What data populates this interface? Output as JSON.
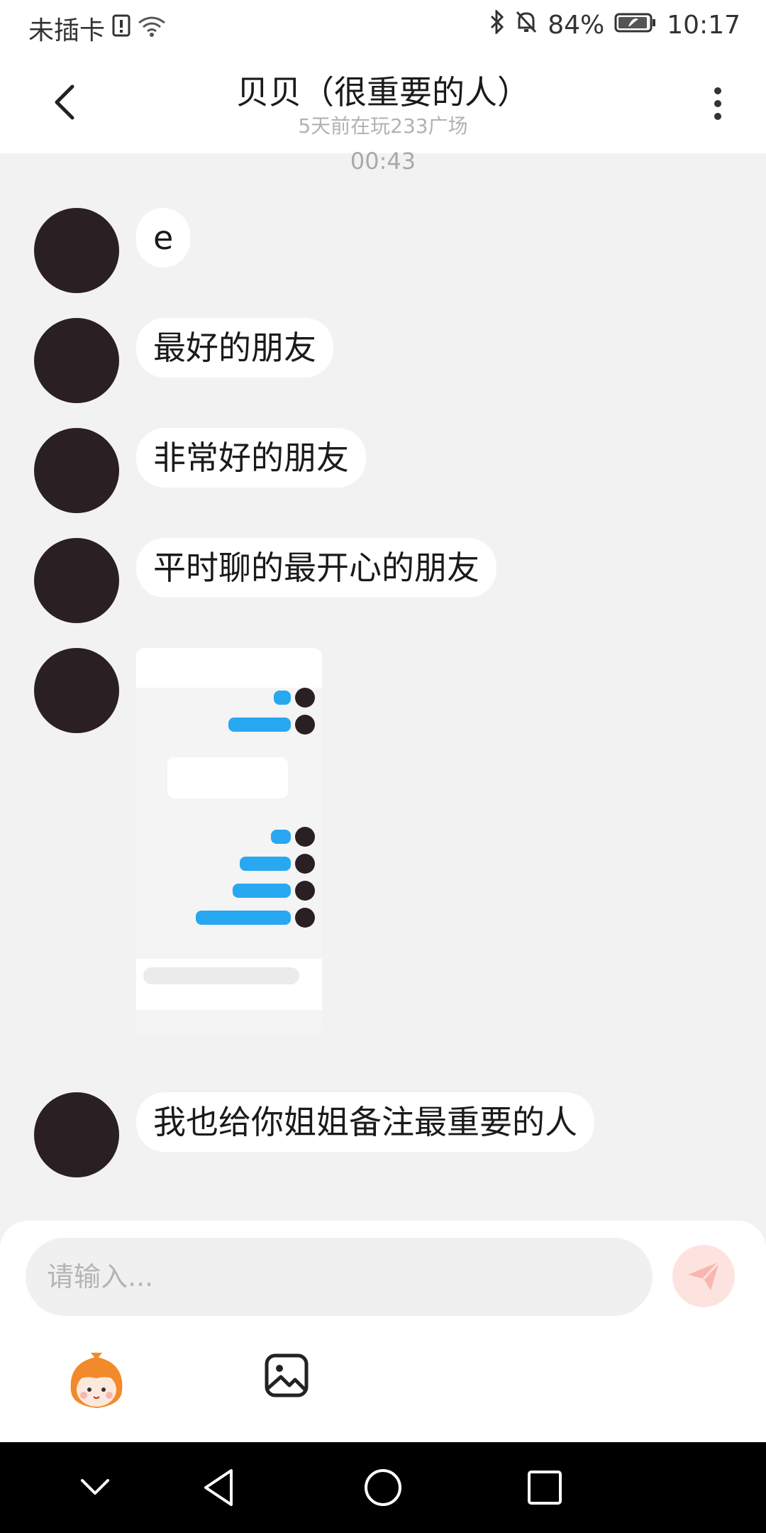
{
  "status": {
    "carrier": "未插卡",
    "battery": "84%",
    "time": "10:17"
  },
  "header": {
    "title": "贝贝（很重要的人）",
    "subtitle": "5天前在玩233广场"
  },
  "chat": {
    "timestamp": "00:43",
    "messages": [
      {
        "type": "text",
        "text": "e"
      },
      {
        "type": "text",
        "text": "最好的朋友"
      },
      {
        "type": "text",
        "text": "非常好的朋友"
      },
      {
        "type": "text",
        "text": "平时聊的最开心的朋友"
      },
      {
        "type": "image"
      },
      {
        "type": "text",
        "text": "我也给你姐姐备注最重要的人"
      }
    ]
  },
  "composer": {
    "placeholder": "请输入..."
  },
  "colors": {
    "accent": "#fde3e0",
    "bubble": "#ffffff",
    "avatar": "#2a1f23",
    "mini_bubble": "#27a8f0"
  }
}
